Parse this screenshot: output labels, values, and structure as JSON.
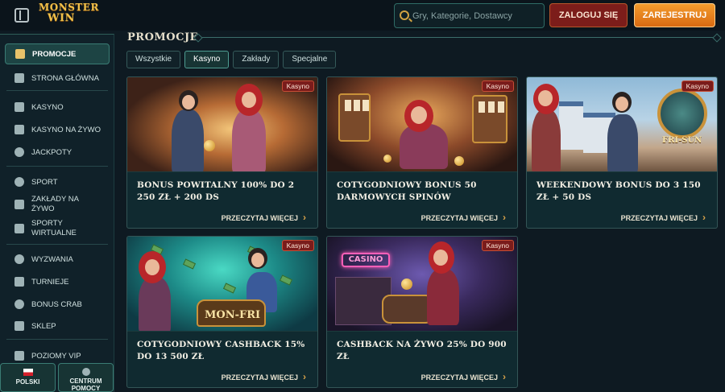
{
  "header": {
    "logo_line1": "MONSTER",
    "logo_line2": "WIN",
    "search_placeholder": "Gry, Kategorie, Dostawcy",
    "login_label": "ZALOGUJ SIĘ",
    "register_label": "ZAREJESTRUJ"
  },
  "sidebar": {
    "items": [
      {
        "label": "PROMOCJE",
        "icon": "gift-icon",
        "active": true
      },
      {
        "label": "STRONA GŁÓWNA",
        "icon": "home-icon"
      },
      {
        "label": "KASYNO",
        "icon": "casino-icon"
      },
      {
        "label": "KASYNO NA ŻYWO",
        "icon": "live-casino-icon"
      },
      {
        "label": "JACKPOTY",
        "icon": "clover-icon"
      },
      {
        "label": "SPORT",
        "icon": "football-icon"
      },
      {
        "label": "ZAKŁADY NA ŻYWO",
        "icon": "live-bet-icon"
      },
      {
        "label": "SPORTY WIRTUALNE",
        "icon": "virtual-sport-icon"
      },
      {
        "label": "WYZWANIA",
        "icon": "medal-icon"
      },
      {
        "label": "TURNIEJE",
        "icon": "trophy-icon"
      },
      {
        "label": "BONUS CRAB",
        "icon": "crab-icon"
      },
      {
        "label": "SKLEP",
        "icon": "shop-icon"
      },
      {
        "label": "POZIOMY VIP",
        "icon": "vip-icon"
      }
    ],
    "language_label": "POLSKI",
    "help_label_line1": "CENTRUM",
    "help_label_line2": "POMOCY"
  },
  "main": {
    "section_title": "PROMOCJE",
    "filters": [
      {
        "label": "Wszystkie",
        "active": false
      },
      {
        "label": "Kasyno",
        "active": true
      },
      {
        "label": "Zakłady",
        "active": false
      },
      {
        "label": "Specjalne",
        "active": false
      }
    ],
    "promotions": [
      {
        "badge": "Kasyno",
        "title": "BONUS POWITALNY 100% DO 2 250 ZŁ + 200 DS",
        "link": "PRZECZYTAJ WIĘCEJ"
      },
      {
        "badge": "Kasyno",
        "title": "COTYGODNIOWY BONUS 50 DARMOWYCH SPINÓW",
        "link": "PRZECZYTAJ WIĘCEJ"
      },
      {
        "badge": "Kasyno",
        "title": "WEEKENDOWY BONUS DO 3 150 ZŁ + 50 DS",
        "link": "PRZECZYTAJ WIĘCEJ",
        "art_text": "FRI-SUN"
      },
      {
        "badge": "Kasyno",
        "title": "COTYGODNIOWY CASHBACK 15% DO 13 500 ZŁ",
        "link": "PRZECZYTAJ WIĘCEJ",
        "art_text": "MON-FRI"
      },
      {
        "badge": "Kasyno",
        "title": "CASHBACK NA ŻYWO 25% DO 900 ZŁ",
        "link": "PRZECZYTAJ WIĘCEJ",
        "art_text": "CASINO"
      }
    ]
  }
}
